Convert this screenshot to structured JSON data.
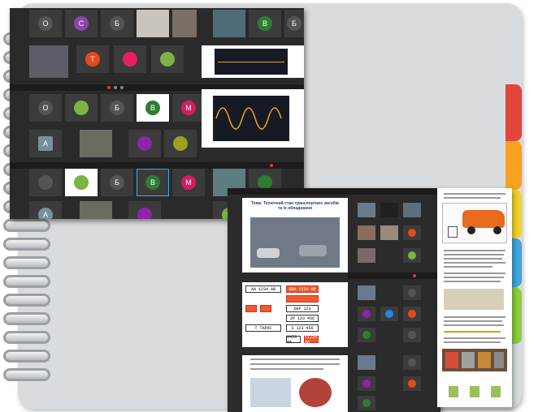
{
  "colors": {
    "notebook": "#d9dcde",
    "tabs": [
      "#e0463b",
      "#f6a21e",
      "#f3d22b",
      "#3ea7dc",
      "#8ccf3e"
    ],
    "accent_red": "#e53935",
    "accent_green": "#2e7d32"
  },
  "rings_count": 19,
  "screenshot_a": {
    "avatar_letters": [
      "O",
      "C",
      "Б",
      "B",
      "Б",
      "T",
      "O",
      "Б",
      "B",
      "M",
      "A",
      "Б",
      "B",
      "M",
      "A",
      "B"
    ]
  },
  "screenshot_b": {
    "slide_title": "Тема: Технічний стан транспортних засобів та їх обладнання",
    "plates": [
      "АА 1234 АВ",
      "BBA 1234 AB",
      "DEP 123",
      "ZP 123 456",
      "S 123 456",
      "Т ТАРАС",
      "8453 AA",
      "F1234 AA"
    ]
  }
}
